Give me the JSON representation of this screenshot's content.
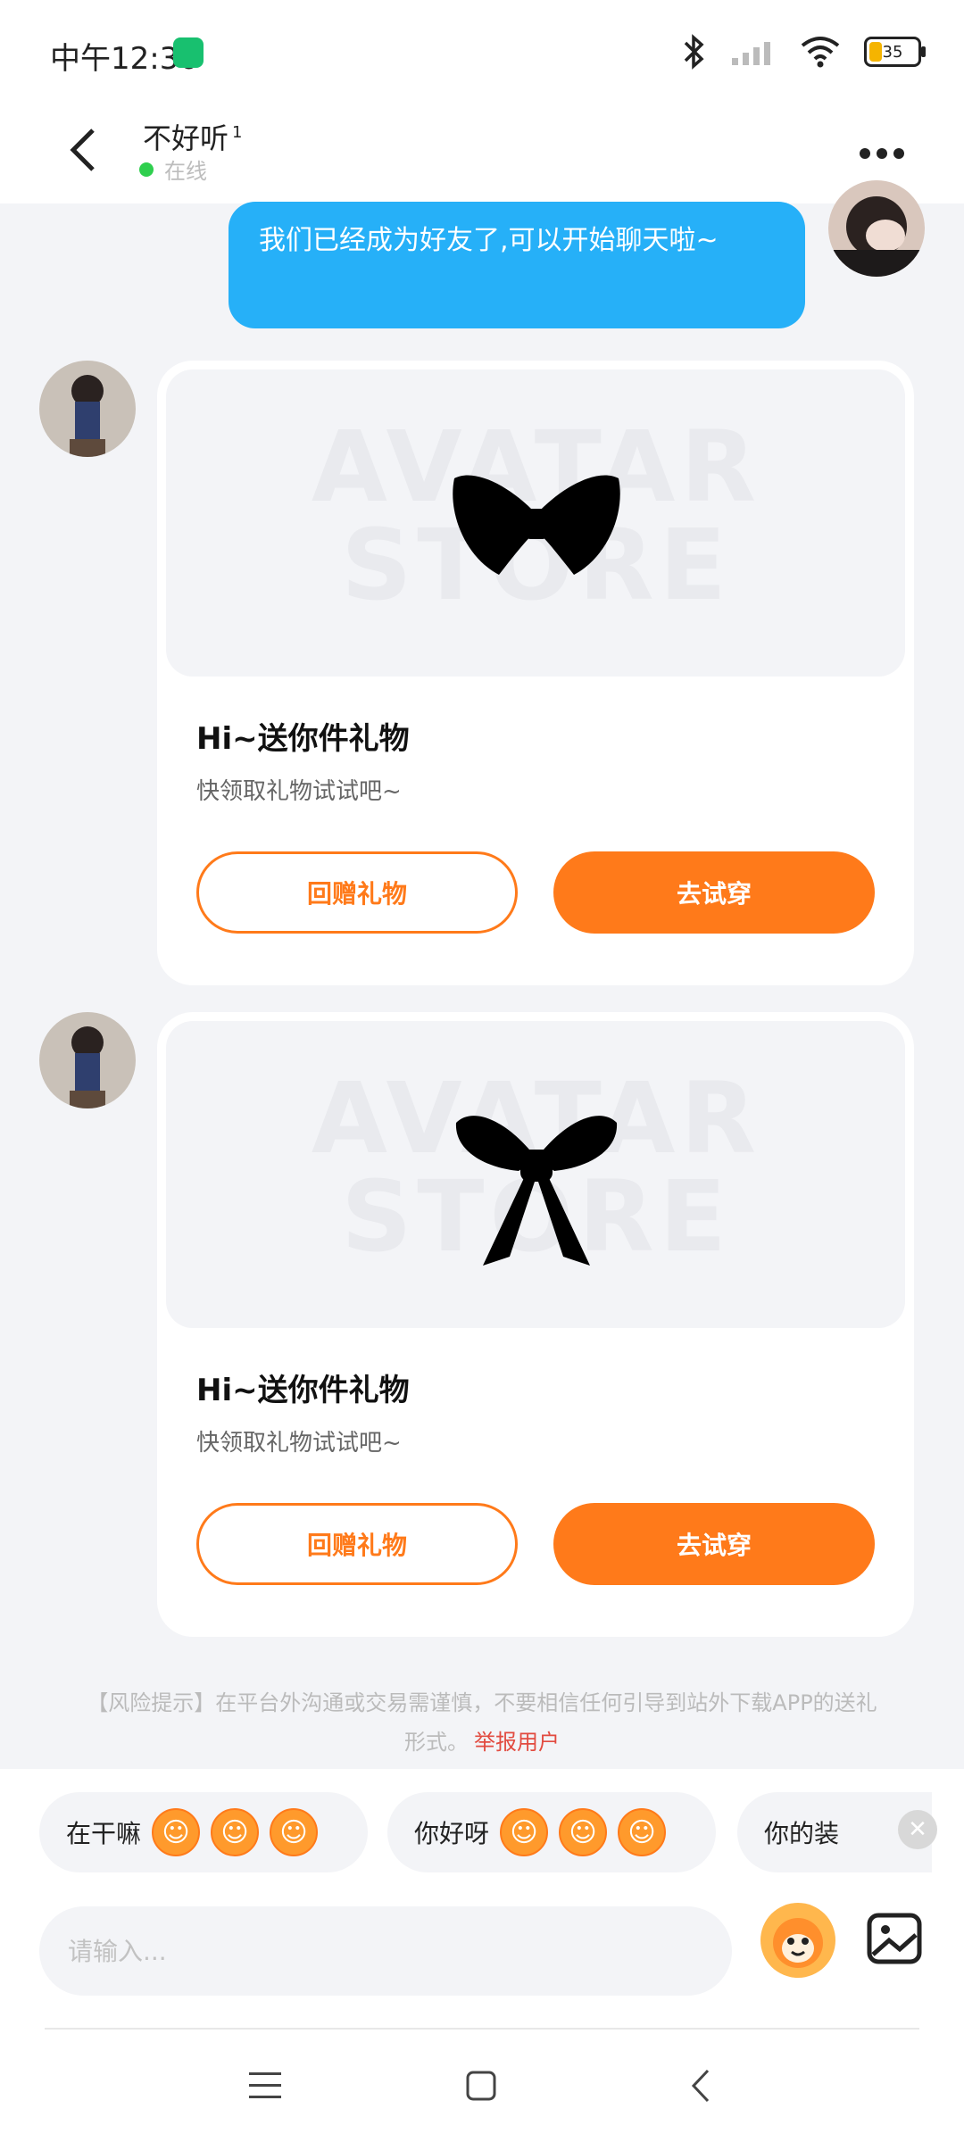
{
  "status": {
    "time": "中午12:36",
    "battery": "35"
  },
  "header": {
    "name": "不好听",
    "badge": "1",
    "status": "在线"
  },
  "messages": {
    "me": "我们已经成为好友了,可以开始聊天啦~"
  },
  "gifts": [
    {
      "watermark_1": "AVATAR",
      "watermark_2": "STORE",
      "heading": "Hi~送你件礼物",
      "sub": "快领取礼物试试吧~",
      "btn_return": "回赠礼物",
      "btn_try": "去试穿"
    },
    {
      "watermark_1": "AVATAR",
      "watermark_2": "STORE",
      "heading": "Hi~送你件礼物",
      "sub": "快领取礼物试试吧~",
      "btn_return": "回赠礼物",
      "btn_try": "去试穿"
    }
  ],
  "risk": {
    "text": "【风险提示】在平台外沟通或交易需谨慎，不要相信任何引导到站外下载APP的送礼形式。",
    "report": "举报用户"
  },
  "chips": [
    {
      "text": "在干嘛"
    },
    {
      "text": "你好呀"
    },
    {
      "text": "你的装"
    }
  ],
  "input": {
    "placeholder": "请输入..."
  },
  "colors": {
    "accent": "#ff7a1a",
    "bubble": "#26b0f8",
    "online": "#2fcf4e"
  }
}
